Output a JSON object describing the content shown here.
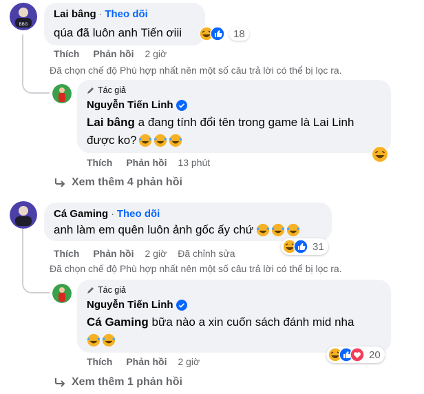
{
  "comments": [
    {
      "author": "Lai bâng",
      "follow": "Theo dõi",
      "text": "qúa đã luôn anh Tiến ơiii",
      "reaction_count": "18",
      "like": "Thích",
      "reply": "Phản hồi",
      "time": "2 giờ",
      "filter_note": "Đã chọn chế độ Phù hợp nhất nên một số câu trả lời có thể bị lọc ra.",
      "author_reply": {
        "badge": "Tác giả",
        "author": "Nguyễn Tiến Linh",
        "mention": "Lai bâng",
        "text_line1": "a đang tính đổi tên trong game là Lai Linh",
        "text_line2": "được ko?",
        "like": "Thích",
        "reply": "Phản hồi",
        "time": "13 phút"
      },
      "more_replies": "Xem thêm 4 phản hồi"
    },
    {
      "author": "Cá Gaming",
      "follow": "Theo dõi",
      "text": "anh làm em quên luôn ảnh gốc ấy chứ",
      "reaction_count": "31",
      "like": "Thích",
      "reply": "Phản hồi",
      "time": "2 giờ",
      "edited": "Đã chỉnh sửa",
      "filter_note": "Đã chọn chế độ Phù hợp nhất nên một số câu trả lời có thể bị lọc ra.",
      "author_reply": {
        "badge": "Tác giả",
        "author": "Nguyễn Tiến Linh",
        "mention": "Cá Gaming",
        "text_line1": "bữa nào a xin cuốn sách đánh mid nha",
        "reaction_count": "20",
        "like": "Thích",
        "reply": "Phản hồi",
        "time": "2 giờ"
      },
      "more_replies": "Xem thêm 1 phản hồi"
    }
  ],
  "colors": {
    "bubble": "#f0f2f5",
    "link_blue": "#0866ff",
    "secondary_text": "#65676b",
    "thread_line": "#ced0d4",
    "haha_yellow": "#f7b125",
    "like_blue": "#0866ff",
    "love_red": "#f33e58"
  },
  "icons": [
    "avatar-lai-bang",
    "avatar-ca-gaming",
    "avatar-nguyen-tien-linh",
    "pencil-icon",
    "verified-badge-icon",
    "haha-emoji-icon",
    "like-reaction-icon",
    "love-reaction-icon",
    "reply-arrow-icon"
  ]
}
